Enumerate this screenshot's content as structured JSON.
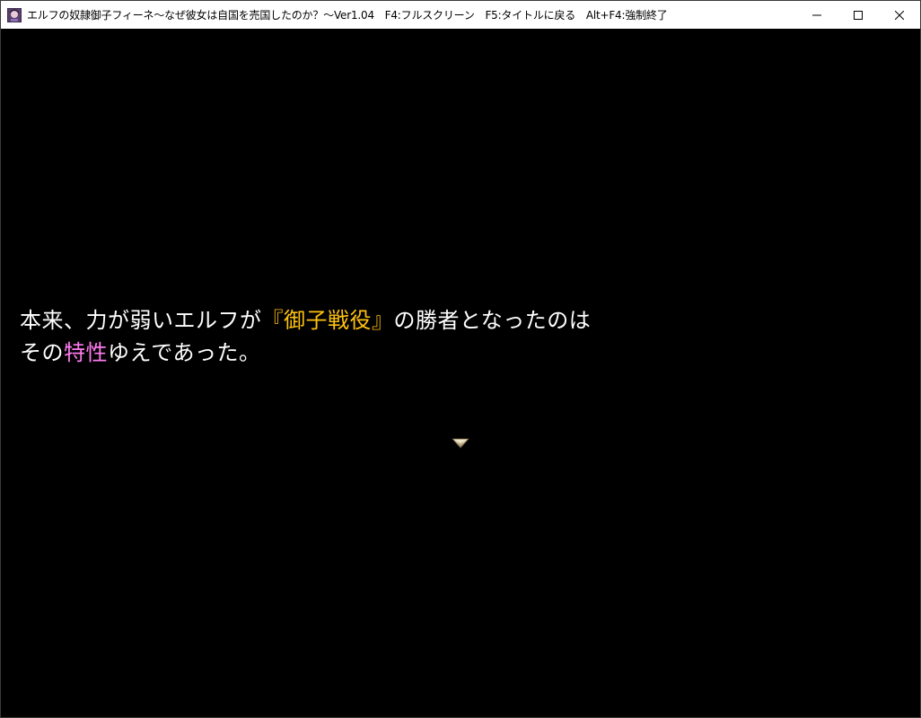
{
  "window": {
    "title": "エルフの奴隷御子フィーネ～なぜ彼女は自国を売国したのか？～Ver1.04　F4:フルスクリーン　F5:タイトルに戻る　Alt+F4:強制終了",
    "icon": "app-character-icon",
    "controls": [
      "minimize-icon",
      "maximize-icon",
      "close-icon"
    ]
  },
  "message": {
    "line1_a": "本来、力が弱いエルフが",
    "line1_highlight": "『御子戦役』",
    "line1_b": "の勝者となったのは",
    "line2_a": "その",
    "line2_highlight": "特性",
    "line2_b": "ゆえであった。"
  },
  "colors": {
    "background": "#000000",
    "text": "#ffffff",
    "highlight_yellow": "#ffc20e",
    "highlight_pink": "#ff7bf0"
  },
  "cursor": {
    "icon": "next-page-arrow-icon"
  }
}
